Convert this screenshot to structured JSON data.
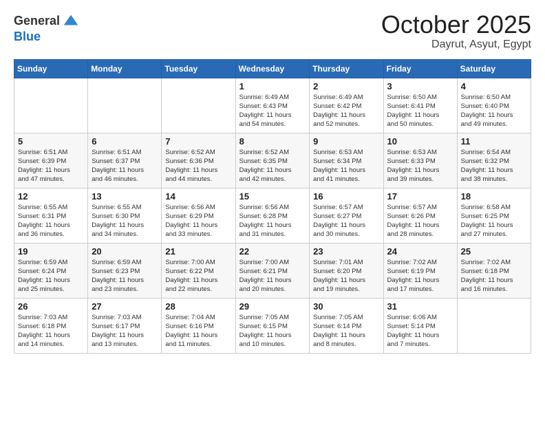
{
  "header": {
    "logo_general": "General",
    "logo_blue": "Blue",
    "month": "October 2025",
    "location": "Dayrut, Asyut, Egypt"
  },
  "weekdays": [
    "Sunday",
    "Monday",
    "Tuesday",
    "Wednesday",
    "Thursday",
    "Friday",
    "Saturday"
  ],
  "weeks": [
    [
      {
        "day": "",
        "info": ""
      },
      {
        "day": "",
        "info": ""
      },
      {
        "day": "",
        "info": ""
      },
      {
        "day": "1",
        "info": "Sunrise: 6:49 AM\nSunset: 6:43 PM\nDaylight: 11 hours\nand 54 minutes."
      },
      {
        "day": "2",
        "info": "Sunrise: 6:49 AM\nSunset: 6:42 PM\nDaylight: 11 hours\nand 52 minutes."
      },
      {
        "day": "3",
        "info": "Sunrise: 6:50 AM\nSunset: 6:41 PM\nDaylight: 11 hours\nand 50 minutes."
      },
      {
        "day": "4",
        "info": "Sunrise: 6:50 AM\nSunset: 6:40 PM\nDaylight: 11 hours\nand 49 minutes."
      }
    ],
    [
      {
        "day": "5",
        "info": "Sunrise: 6:51 AM\nSunset: 6:39 PM\nDaylight: 11 hours\nand 47 minutes."
      },
      {
        "day": "6",
        "info": "Sunrise: 6:51 AM\nSunset: 6:37 PM\nDaylight: 11 hours\nand 46 minutes."
      },
      {
        "day": "7",
        "info": "Sunrise: 6:52 AM\nSunset: 6:36 PM\nDaylight: 11 hours\nand 44 minutes."
      },
      {
        "day": "8",
        "info": "Sunrise: 6:52 AM\nSunset: 6:35 PM\nDaylight: 11 hours\nand 42 minutes."
      },
      {
        "day": "9",
        "info": "Sunrise: 6:53 AM\nSunset: 6:34 PM\nDaylight: 11 hours\nand 41 minutes."
      },
      {
        "day": "10",
        "info": "Sunrise: 6:53 AM\nSunset: 6:33 PM\nDaylight: 11 hours\nand 39 minutes."
      },
      {
        "day": "11",
        "info": "Sunrise: 6:54 AM\nSunset: 6:32 PM\nDaylight: 11 hours\nand 38 minutes."
      }
    ],
    [
      {
        "day": "12",
        "info": "Sunrise: 6:55 AM\nSunset: 6:31 PM\nDaylight: 11 hours\nand 36 minutes."
      },
      {
        "day": "13",
        "info": "Sunrise: 6:55 AM\nSunset: 6:30 PM\nDaylight: 11 hours\nand 34 minutes."
      },
      {
        "day": "14",
        "info": "Sunrise: 6:56 AM\nSunset: 6:29 PM\nDaylight: 11 hours\nand 33 minutes."
      },
      {
        "day": "15",
        "info": "Sunrise: 6:56 AM\nSunset: 6:28 PM\nDaylight: 11 hours\nand 31 minutes."
      },
      {
        "day": "16",
        "info": "Sunrise: 6:57 AM\nSunset: 6:27 PM\nDaylight: 11 hours\nand 30 minutes."
      },
      {
        "day": "17",
        "info": "Sunrise: 6:57 AM\nSunset: 6:26 PM\nDaylight: 11 hours\nand 28 minutes."
      },
      {
        "day": "18",
        "info": "Sunrise: 6:58 AM\nSunset: 6:25 PM\nDaylight: 11 hours\nand 27 minutes."
      }
    ],
    [
      {
        "day": "19",
        "info": "Sunrise: 6:59 AM\nSunset: 6:24 PM\nDaylight: 11 hours\nand 25 minutes."
      },
      {
        "day": "20",
        "info": "Sunrise: 6:59 AM\nSunset: 6:23 PM\nDaylight: 11 hours\nand 23 minutes."
      },
      {
        "day": "21",
        "info": "Sunrise: 7:00 AM\nSunset: 6:22 PM\nDaylight: 11 hours\nand 22 minutes."
      },
      {
        "day": "22",
        "info": "Sunrise: 7:00 AM\nSunset: 6:21 PM\nDaylight: 11 hours\nand 20 minutes."
      },
      {
        "day": "23",
        "info": "Sunrise: 7:01 AM\nSunset: 6:20 PM\nDaylight: 11 hours\nand 19 minutes."
      },
      {
        "day": "24",
        "info": "Sunrise: 7:02 AM\nSunset: 6:19 PM\nDaylight: 11 hours\nand 17 minutes."
      },
      {
        "day": "25",
        "info": "Sunrise: 7:02 AM\nSunset: 6:18 PM\nDaylight: 11 hours\nand 16 minutes."
      }
    ],
    [
      {
        "day": "26",
        "info": "Sunrise: 7:03 AM\nSunset: 6:18 PM\nDaylight: 11 hours\nand 14 minutes."
      },
      {
        "day": "27",
        "info": "Sunrise: 7:03 AM\nSunset: 6:17 PM\nDaylight: 11 hours\nand 13 minutes."
      },
      {
        "day": "28",
        "info": "Sunrise: 7:04 AM\nSunset: 6:16 PM\nDaylight: 11 hours\nand 11 minutes."
      },
      {
        "day": "29",
        "info": "Sunrise: 7:05 AM\nSunset: 6:15 PM\nDaylight: 11 hours\nand 10 minutes."
      },
      {
        "day": "30",
        "info": "Sunrise: 7:05 AM\nSunset: 6:14 PM\nDaylight: 11 hours\nand 8 minutes."
      },
      {
        "day": "31",
        "info": "Sunrise: 6:06 AM\nSunset: 5:14 PM\nDaylight: 11 hours\nand 7 minutes."
      },
      {
        "day": "",
        "info": ""
      }
    ]
  ]
}
